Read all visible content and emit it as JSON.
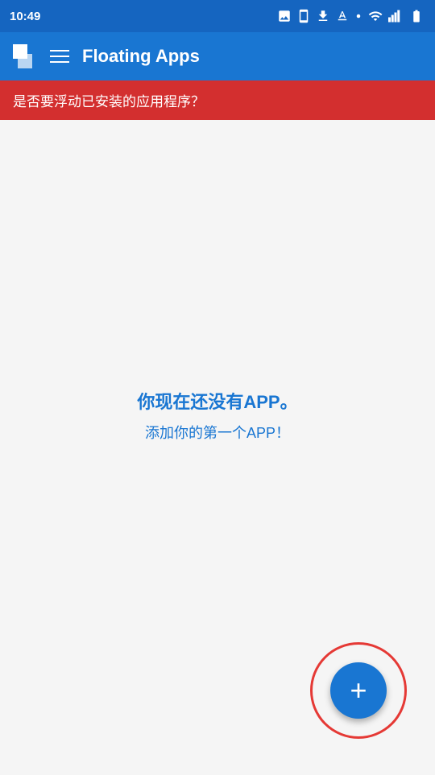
{
  "statusBar": {
    "time": "10:49"
  },
  "appBar": {
    "title": "Floating Apps"
  },
  "banner": {
    "text": "是否要浮动已安装的应用程序？"
  },
  "emptyState": {
    "line1": "你现在还没有APP。",
    "line2": "添加你的第一个APP！"
  },
  "fab": {
    "label": "+"
  },
  "colors": {
    "appBar": "#1976d2",
    "banner": "#d32f2f",
    "fabRing": "#e53935",
    "fabButton": "#1976d2"
  }
}
